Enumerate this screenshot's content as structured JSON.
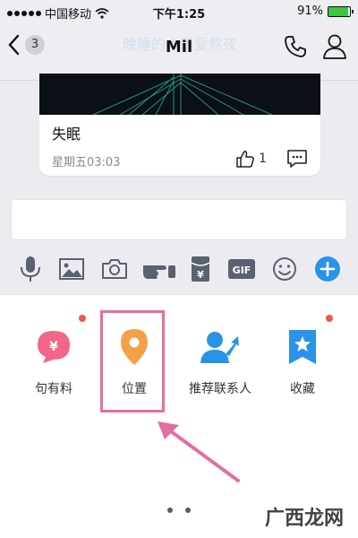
{
  "status": {
    "carrier": "中国移动",
    "time": "下午1:25",
    "battery": "91%",
    "battery_level": 0.91
  },
  "header": {
    "back_count": "3",
    "title": "Mil",
    "banner_text": "晚睡的人最爱熬夜"
  },
  "card": {
    "title": "失眠",
    "date": "星期五03:03",
    "like_count": "1"
  },
  "input": {
    "value": "",
    "placeholder": ""
  },
  "toolbar": {
    "items": [
      "voice-icon",
      "image-icon",
      "camera-icon",
      "poke-icon",
      "red-packet-icon",
      "gif-icon",
      "emoji-icon",
      "plus-icon"
    ],
    "gif_label": "GIF",
    "red_packet_symbol": "¥"
  },
  "panel": {
    "actions": [
      {
        "label": "句有料",
        "icon": "yuan-bubble-icon",
        "badge": true
      },
      {
        "label": "位置",
        "icon": "location-pin-icon",
        "badge": false
      },
      {
        "label": "推荐联系人",
        "icon": "recommend-contact-icon",
        "badge": false
      },
      {
        "label": "收藏",
        "icon": "favorite-bookmark-icon",
        "badge": true
      }
    ],
    "yuan_symbol": "¥",
    "pages": 2
  },
  "colors": {
    "accent_blue": "#2a93e8",
    "pin_orange": "#f5a048",
    "bubble_pink": "#f2668a",
    "highlight_pink": "#e26fa2",
    "badge_red": "#f0564a"
  },
  "watermark": "广西龙网"
}
